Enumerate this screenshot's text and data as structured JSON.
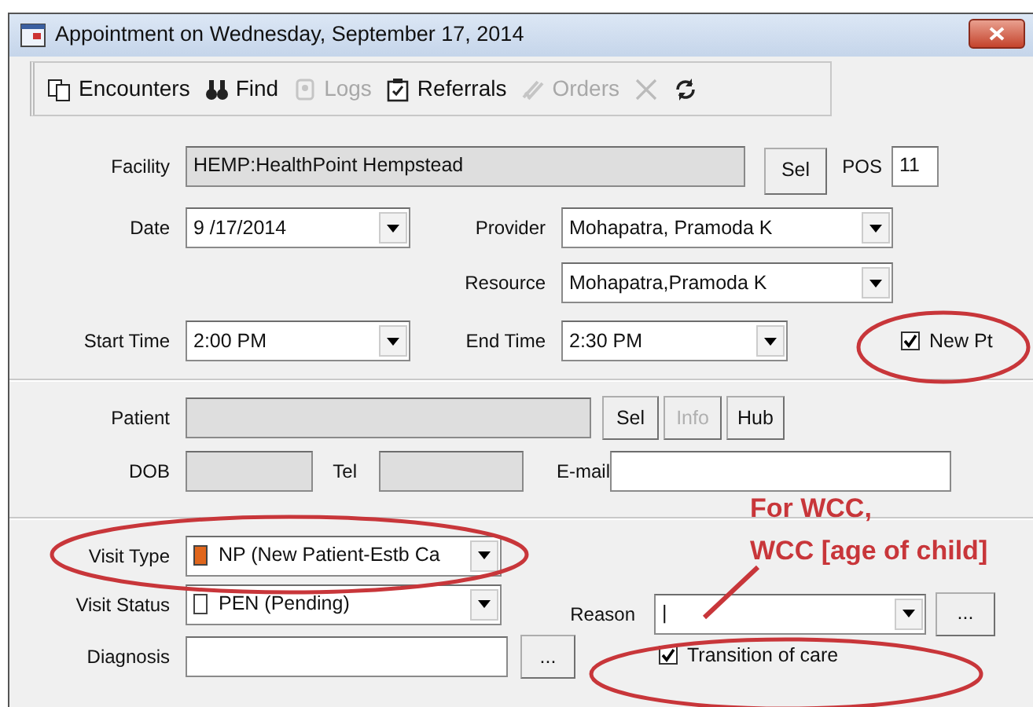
{
  "window": {
    "title": "Appointment on Wednesday, September 17, 2014"
  },
  "toolbar": [
    {
      "kind": "encounters",
      "label": "Encounters",
      "disabled": false
    },
    {
      "kind": "find",
      "label": "Find",
      "disabled": false
    },
    {
      "kind": "logs",
      "label": "Logs",
      "disabled": true
    },
    {
      "kind": "referrals",
      "label": "Referrals",
      "disabled": false
    },
    {
      "kind": "orders",
      "label": "Orders",
      "disabled": true
    },
    {
      "kind": "delete",
      "disabled": true
    },
    {
      "kind": "refresh",
      "disabled": false
    }
  ],
  "facility": {
    "label": "Facility",
    "value": "HEMP:HealthPoint Hempstead",
    "disabled": true,
    "button": "Sel",
    "pos_label": "POS",
    "pos_value": "11"
  },
  "date": {
    "label": "Date",
    "value": "9 /17/2014"
  },
  "provider": {
    "label": "Provider",
    "value": "Mohapatra, Pramoda K"
  },
  "resource": {
    "label": "Resource",
    "value": "Mohapatra,Pramoda K"
  },
  "start_time": {
    "label": "Start Time",
    "value": "2:00 PM"
  },
  "end_time": {
    "label": "End Time",
    "value": "2:30 PM"
  },
  "new_pt": {
    "label": "New Pt",
    "checked": true
  },
  "patient": {
    "label": "Patient",
    "disabled": true,
    "buttons": [
      {
        "label": "Sel",
        "disabled": false
      },
      {
        "label": "Info",
        "disabled": true
      },
      {
        "label": "Hub",
        "disabled": false
      }
    ]
  },
  "dob": {
    "label": "DOB",
    "disabled": true
  },
  "tel": {
    "label": "Tel",
    "disabled": true
  },
  "email": {
    "label": "E-mail",
    "disabled": false
  },
  "visit_type": {
    "label": "Visit Type",
    "value": "NP (New Patient-Estb Ca",
    "color": "#e0661c"
  },
  "visit_status": {
    "label": "Visit Status",
    "value": "PEN (Pending)",
    "color": "#ffffff"
  },
  "reason": {
    "label": "Reason",
    "value": "|",
    "button": "..."
  },
  "diagnosis": {
    "label": "Diagnosis",
    "button": "..."
  },
  "transition_of_care": {
    "label": "Transition of care",
    "checked": true
  },
  "annotation": {
    "lines": [
      "For WCC,",
      "WCC [age of child]"
    ]
  }
}
